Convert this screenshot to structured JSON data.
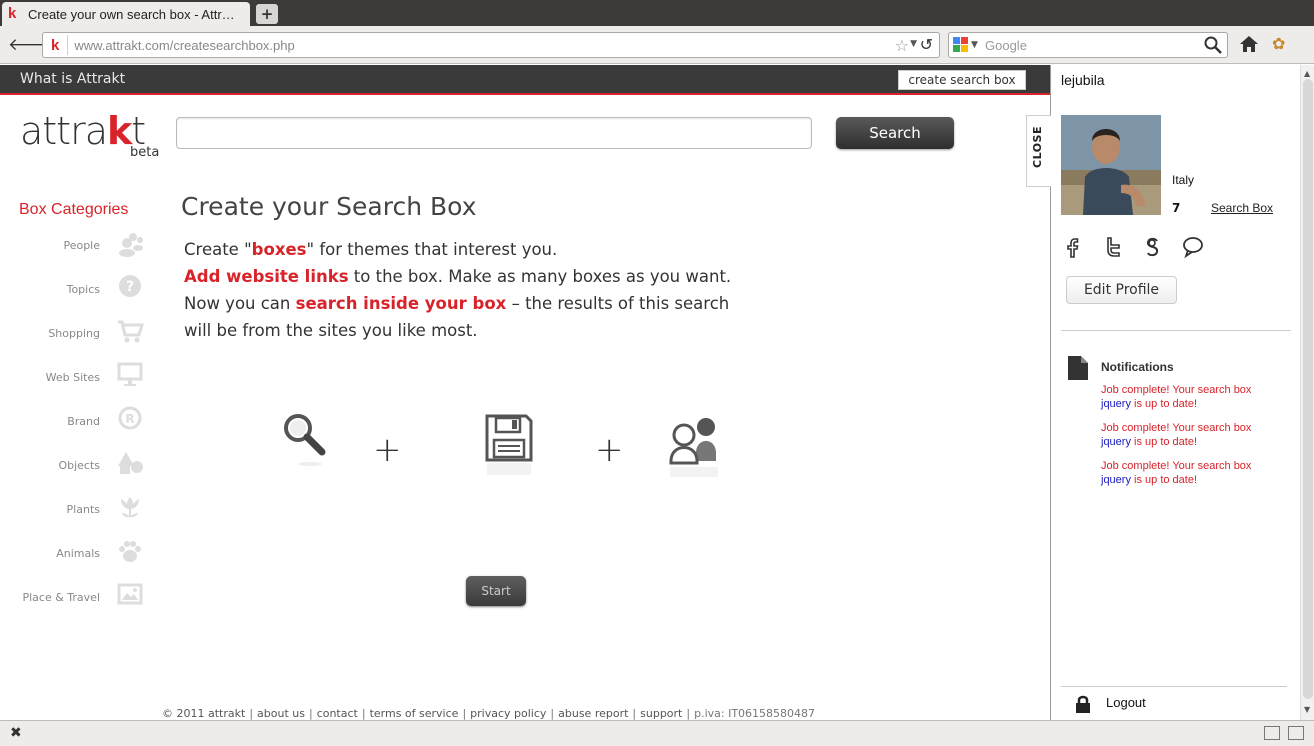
{
  "browser": {
    "tab_title": "Create your own search box - Attr…",
    "new_tab_symbol": "+",
    "url_host": "www.attrakt.com",
    "url_path": "/createsearchbox.php",
    "search_placeholder": "Google"
  },
  "topbar": {
    "what_is_label": "What is Attrakt",
    "create_box_label": "create search box"
  },
  "logo": {
    "text_pre": "attra",
    "text_k": "k",
    "text_post": "t",
    "beta": "beta"
  },
  "search": {
    "button_label": "Search",
    "value": ""
  },
  "categories": {
    "title": "Box Categories",
    "items": [
      {
        "label": "People",
        "icon": "people-icon"
      },
      {
        "label": "Topics",
        "icon": "question-icon"
      },
      {
        "label": "Shopping",
        "icon": "cart-icon"
      },
      {
        "label": "Web Sites",
        "icon": "monitor-icon"
      },
      {
        "label": "Brand",
        "icon": "registered-icon"
      },
      {
        "label": "Objects",
        "icon": "shapes-icon"
      },
      {
        "label": "Plants",
        "icon": "flower-icon"
      },
      {
        "label": "Animals",
        "icon": "paw-icon"
      },
      {
        "label": "Place & Travel",
        "icon": "picture-icon"
      }
    ]
  },
  "main": {
    "heading": "Create your Search Box",
    "line1_pre": "Create \"",
    "line1_bold": "boxes",
    "line1_post": "\" for themes that interest you.",
    "line2_bold": "Add website links",
    "line2_post": " to the box. Make as many boxes as you want.",
    "line3_pre": "Now you can ",
    "line3_bold": "search inside your box",
    "line3_post": " – the results of this search",
    "line4": "will be from the sites you like most.",
    "plus": "+",
    "start_label": "Start"
  },
  "footer": {
    "copyright": "© 2011 attrakt",
    "links": [
      "about us",
      "contact",
      "terms of service",
      "privacy policy",
      "abuse report",
      "support"
    ],
    "vat": "p.iva: IT06158580487"
  },
  "profile": {
    "close_label": "CLOSE",
    "username": "lejubila",
    "country": "Italy",
    "box_count": "7",
    "search_box_link": "Search Box",
    "edit_label": "Edit Profile",
    "notifications_title": "Notifications",
    "notifications": [
      {
        "pre": "Job complete! Your search box",
        "box": "jquery",
        "post": " is up to date!"
      },
      {
        "pre": "Job complete! Your search box",
        "box": "jquery",
        "post": " is up to date!"
      },
      {
        "pre": "Job complete! Your search box",
        "box": "jquery",
        "post": " is up to date!"
      }
    ],
    "logout_label": "Logout"
  },
  "colors": {
    "accent": "#d8232a",
    "dark_bar": "#3a3a3a",
    "link_blue": "#1a1abc"
  }
}
